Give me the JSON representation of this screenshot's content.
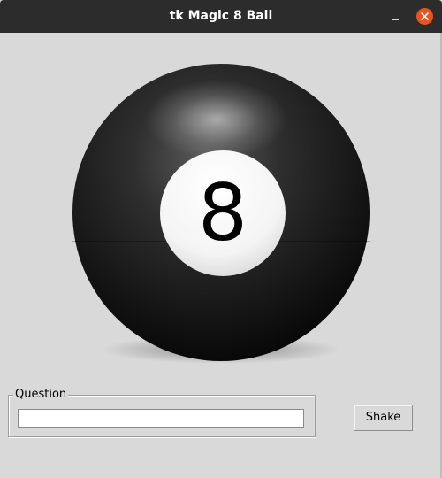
{
  "window": {
    "title": "tk Magic 8 Ball"
  },
  "ball": {
    "number": "8"
  },
  "question": {
    "label": "Question",
    "value": ""
  },
  "actions": {
    "shake_label": "Shake"
  },
  "colors": {
    "titlebar": "#2c2c2c",
    "close_button": "#e95420",
    "window_background": "#d9d9d9"
  },
  "icons": {
    "minimize": "minimize-icon",
    "close": "close-icon"
  }
}
